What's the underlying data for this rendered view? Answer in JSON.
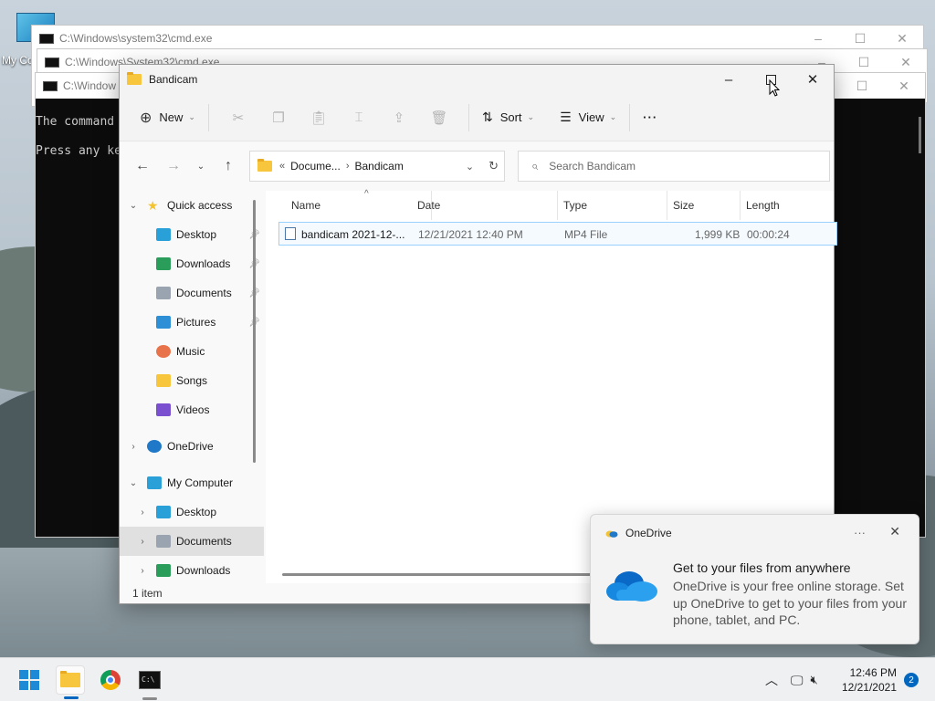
{
  "desktop": {
    "icon_label": "My Co"
  },
  "cmd_windows": [
    {
      "title": "C:\\Windows\\system32\\cmd.exe"
    },
    {
      "title": "C:\\Windows\\System32\\cmd.exe"
    },
    {
      "title": "C:\\Window"
    }
  ],
  "cmd_text": {
    "line1": "The command",
    "line2": "Press any ke"
  },
  "explorer": {
    "title": "Bandicam",
    "controls": {
      "minimize": "–",
      "maximize": "",
      "close": "✕"
    },
    "toolbar": {
      "new_label": "New",
      "sort_label": "Sort",
      "view_label": "View",
      "more_label": "···"
    },
    "address": {
      "overflow": "«",
      "crumb1": "Docume...",
      "crumb2": "Bandicam"
    },
    "search": {
      "placeholder": "Search Bandicam"
    },
    "nav": [
      {
        "label": "Quick access",
        "indent": 0,
        "expander": "⌄",
        "icon": "star-icon",
        "pinned": false
      },
      {
        "label": "Desktop",
        "indent": 1,
        "expander": "",
        "icon": "desktop-icon",
        "pinned": true
      },
      {
        "label": "Downloads",
        "indent": 1,
        "expander": "",
        "icon": "download-icon",
        "pinned": true
      },
      {
        "label": "Documents",
        "indent": 1,
        "expander": "",
        "icon": "documents-icon",
        "pinned": true
      },
      {
        "label": "Pictures",
        "indent": 1,
        "expander": "",
        "icon": "pictures-icon",
        "pinned": true
      },
      {
        "label": "Music",
        "indent": 1,
        "expander": "",
        "icon": "music-icon",
        "pinned": false
      },
      {
        "label": "Songs",
        "indent": 1,
        "expander": "",
        "icon": "folder-icon",
        "pinned": false
      },
      {
        "label": "Videos",
        "indent": 1,
        "expander": "",
        "icon": "videos-icon",
        "pinned": false
      },
      {
        "label": "OneDrive",
        "indent": 0,
        "expander": "›",
        "icon": "cloud-icon",
        "pinned": false
      },
      {
        "label": "My Computer",
        "indent": 0,
        "expander": "⌄",
        "icon": "computer-icon",
        "pinned": false
      },
      {
        "label": "Desktop",
        "indent": 1,
        "expander": "›",
        "icon": "desktop-icon",
        "pinned": false
      },
      {
        "label": "Documents",
        "indent": 1,
        "expander": "›",
        "icon": "documents-icon",
        "pinned": false,
        "selected": true
      },
      {
        "label": "Downloads",
        "indent": 1,
        "expander": "›",
        "icon": "download-icon",
        "pinned": false
      }
    ],
    "columns": {
      "name": "Name",
      "date": "Date",
      "type": "Type",
      "size": "Size",
      "length": "Length"
    },
    "files": [
      {
        "name": "bandicam 2021-12-...",
        "date": "12/21/2021 12:40 PM",
        "type": "MP4 File",
        "size": "1,999 KB",
        "length": "00:00:24"
      }
    ],
    "status": "1 item"
  },
  "toast": {
    "app": "OneDrive",
    "more": "···",
    "close": "✕",
    "heading": "Get to your files from anywhere",
    "body": "OneDrive is your free online storage. Set up OneDrive to get to your files from your phone, tablet, and PC."
  },
  "taskbar": {
    "time": "12:46 PM",
    "date": "12/21/2021",
    "notifications": "2"
  },
  "colors": {
    "accent": "#0067c0",
    "folder": "#f8c63d",
    "selection_border": "#99d1ff"
  }
}
